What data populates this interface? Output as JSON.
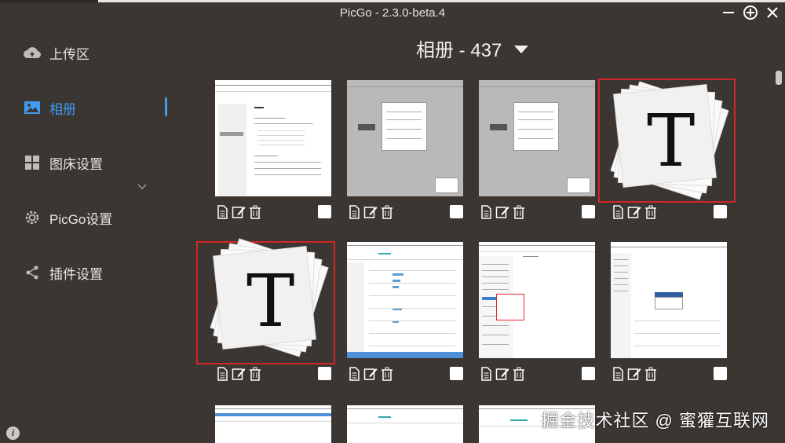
{
  "window": {
    "title": "PicGo - 2.3.0-beta.4"
  },
  "sidebar": {
    "items": [
      {
        "label": "上传区",
        "icon": "cloud-upload-icon"
      },
      {
        "label": "相册",
        "icon": "image-icon",
        "active": true
      },
      {
        "label": "图床设置",
        "icon": "grid-icon"
      },
      {
        "label": "PicGo设置",
        "icon": "gear-icon"
      },
      {
        "label": "插件设置",
        "icon": "share-icon"
      }
    ]
  },
  "album": {
    "title": "相册 - 437"
  },
  "gallery": {
    "cards": [
      {
        "kind": "screenshot-settings",
        "selected": false
      },
      {
        "kind": "screenshot-gray",
        "selected": false
      },
      {
        "kind": "screenshot-gray",
        "selected": false
      },
      {
        "kind": "typora-logo",
        "selected": true,
        "letter": "T"
      },
      {
        "kind": "typora-logo",
        "selected": true,
        "letter": "T"
      },
      {
        "kind": "screenshot-table",
        "selected": false
      },
      {
        "kind": "screenshot-tree",
        "selected": false
      },
      {
        "kind": "screenshot-dialog",
        "selected": false
      }
    ]
  },
  "watermark": "掘金技术社区 @ 蜜獾互联网",
  "colors": {
    "accent": "#3f9cf2",
    "background": "#3b3632",
    "selection": "#d32626"
  }
}
